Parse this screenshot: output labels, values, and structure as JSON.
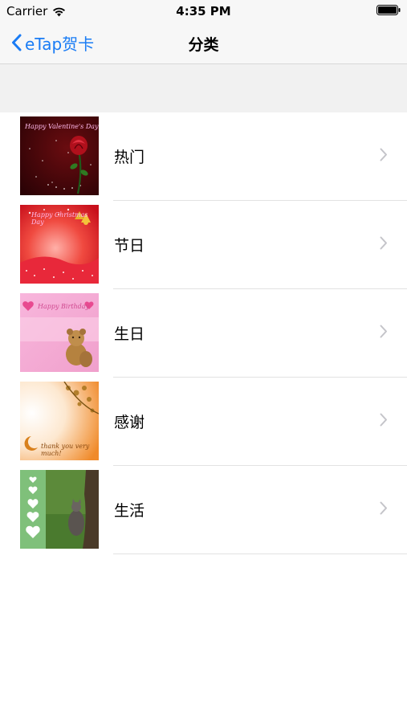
{
  "status_bar": {
    "carrier": "Carrier",
    "time": "4:35 PM"
  },
  "nav": {
    "back_label": "eTap贺卡",
    "title": "分类"
  },
  "categories": [
    {
      "label": "热门"
    },
    {
      "label": "节日"
    },
    {
      "label": "生日"
    },
    {
      "label": "感谢"
    },
    {
      "label": "生活"
    }
  ],
  "colors": {
    "accent": "#1a7cf5",
    "chevron": "#c4c4c9",
    "separator": "#e2e2e2"
  }
}
